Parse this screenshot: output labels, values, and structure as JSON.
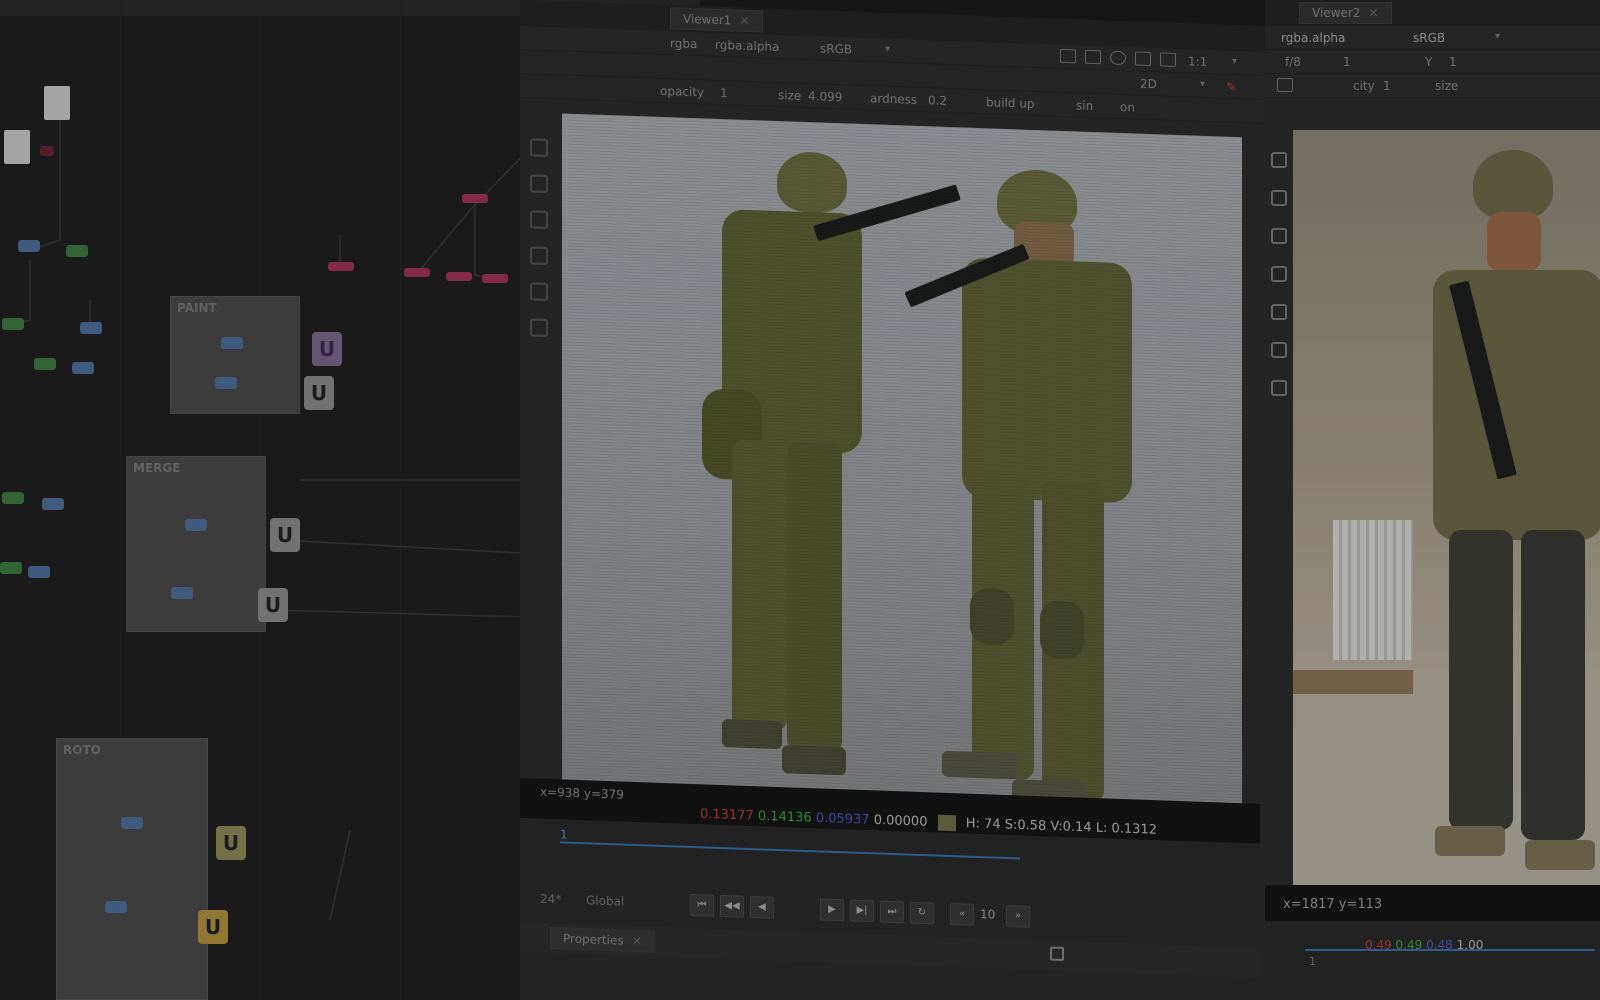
{
  "viewer1": {
    "tab_title": "Viewer1",
    "channel": "rgba",
    "channel_mode": "rgba.alpha",
    "colorspace": "sRGB",
    "zoom": "1:1",
    "view_mode": "2D",
    "paint": {
      "opacity_label": "opacity",
      "opacity_value": "1",
      "size_label": "size",
      "size_value": "4.099",
      "hardness_label": "ardness",
      "hardness_value": "0.2",
      "buildup_label": "build up",
      "mode_value": "sin",
      "on_value": "on"
    },
    "cursor_coords": "x=938 y=379",
    "pixel": {
      "r": "0.13177",
      "g": "0.14136",
      "b": "0.05937",
      "a": "0.00000",
      "hsv": "H: 74 S:0.58 V:0.14",
      "l": "L: 0.1312"
    },
    "timeline_fps": "24*",
    "timeline_scope": "Global",
    "frame_increment": "10",
    "current_frame": "1",
    "properties_tab": "Properties"
  },
  "viewer2": {
    "tab_title": "Viewer2",
    "channel_mode": "rgba.alpha",
    "colorspace": "sRGB",
    "fstop": "f/8",
    "frame": "1",
    "y_label": "Y",
    "y_value": "1",
    "opacity_label": "city",
    "opacity_value": "1",
    "size_label": "size",
    "cursor_coords": "x=1817 y=113",
    "pixel": {
      "r": "0.49",
      "g": "0.49",
      "b": "0.48",
      "a": "1.00"
    },
    "frame_start": "1"
  },
  "node_graph": {
    "backdrops": [
      {
        "label": "PAINT"
      },
      {
        "label": "MERGE"
      },
      {
        "label": "ROTO"
      }
    ]
  },
  "colors": {
    "accent": "#3b6ea8",
    "node_pink": "#a2345a",
    "node_blue": "#4f6d9a",
    "node_green": "#3f7a45",
    "bg": "#1b1b1c"
  }
}
